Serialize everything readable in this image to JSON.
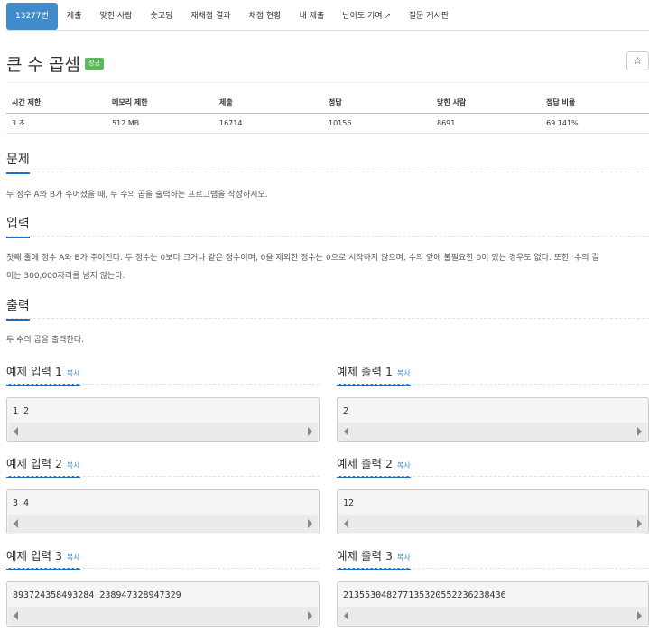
{
  "tabs": [
    {
      "label": "13277번",
      "active": true
    },
    {
      "label": "제출"
    },
    {
      "label": "맞힌 사람"
    },
    {
      "label": "숏코딩"
    },
    {
      "label": "재채점 결과"
    },
    {
      "label": "채점 현황"
    },
    {
      "label": "내 제출"
    },
    {
      "label": "난이도 기여"
    },
    {
      "label": "질문 게시판"
    }
  ],
  "problem": {
    "title": "큰 수 곱셈",
    "badge": "성공",
    "star": "☆"
  },
  "stats": {
    "headers": [
      "시간 제한",
      "메모리 제한",
      "제출",
      "정답",
      "맞힌 사람",
      "정답 비율"
    ],
    "values": [
      "3 초",
      "512 MB",
      "16714",
      "10156",
      "8691",
      "69.141%"
    ]
  },
  "sections": {
    "problem_h": "문제",
    "problem_text": "두 정수 A와 B가 주어졌을 때, 두 수의 곱을 출력하는 프로그램을 작성하시오.",
    "input_h": "입력",
    "input_text_1": "첫째 줄에 정수 A와 B가 주어진다. 두 정수는 0보다 크거나 같은 정수이며, 0을 제외한 정수는 0으로 시작하지 않으며, 수의 앞에 불필요한 0이 있는 경우도 없다. 또한, 수의 길",
    "input_text_2": "이는 300,000자리를 넘지 않는다.",
    "output_h": "출력",
    "output_text": "두 수의 곱을 출력한다."
  },
  "copy_label": "복사",
  "examples": [
    {
      "in_title": "예제 입력 1",
      "in": "1 2",
      "out_title": "예제 출력 1",
      "out": "2"
    },
    {
      "in_title": "예제 입력 2",
      "in": "3 4",
      "out_title": "예제 출력 2",
      "out": "12"
    },
    {
      "in_title": "예제 입력 3",
      "in": "893724358493284 238947328947329",
      "out_title": "예제 출력 3",
      "out": "213553048277135320552236238436"
    }
  ]
}
